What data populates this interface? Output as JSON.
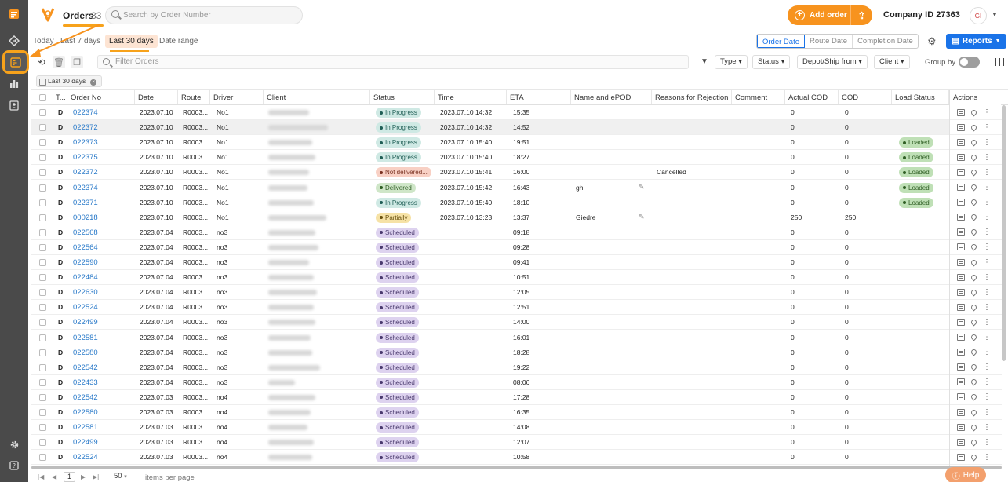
{
  "header": {
    "title": "Orders",
    "count": "33",
    "search_placeholder": "Search by Order Number",
    "add_order": "Add order",
    "company": "Company ID 27363",
    "avatar": "GI"
  },
  "date_tabs": [
    "Today",
    "Last 7 days",
    "Last 30 days",
    "Date range"
  ],
  "date_mode": [
    "Order Date",
    "Route Date",
    "Completion Date"
  ],
  "reports_label": "Reports",
  "filter_placeholder": "Filter Orders",
  "dropdowns": [
    "Type",
    "Status",
    "Depot/Ship from",
    "Client"
  ],
  "group_by": "Group by",
  "chip": "Last 30 days",
  "columns": [
    "T...",
    "Order No",
    "Date",
    "Route",
    "Driver",
    "Client",
    "Status",
    "Time",
    "ETA",
    "Name and ePOD",
    "Reasons for Rejection",
    "Comment",
    "Actual COD",
    "COD",
    "Load Status"
  ],
  "actions_label": "Actions",
  "rows": [
    {
      "t": "D",
      "order": "022374",
      "date": "2023.07.10",
      "route": "R0003...",
      "driver": "No1",
      "status": "In Progress",
      "status_type": "progress",
      "time": "2023.07.10 14:32",
      "eta": "15:35",
      "epod": "",
      "pen": false,
      "reason": "",
      "actual_cod": "0",
      "cod": "0",
      "load": ""
    },
    {
      "t": "D",
      "order": "022372",
      "date": "2023.07.10",
      "route": "R0003...",
      "driver": "No1",
      "status": "In Progress",
      "status_type": "progress",
      "time": "2023.07.10 14:32",
      "eta": "14:52",
      "epod": "",
      "pen": false,
      "reason": "",
      "actual_cod": "0",
      "cod": "0",
      "load": ""
    },
    {
      "t": "D",
      "order": "022373",
      "date": "2023.07.10",
      "route": "R0003...",
      "driver": "No1",
      "status": "In Progress",
      "status_type": "progress",
      "time": "2023.07.10 15:40",
      "eta": "19:51",
      "epod": "",
      "pen": false,
      "reason": "",
      "actual_cod": "0",
      "cod": "0",
      "load": "Loaded"
    },
    {
      "t": "D",
      "order": "022375",
      "date": "2023.07.10",
      "route": "R0003...",
      "driver": "No1",
      "status": "In Progress",
      "status_type": "progress",
      "time": "2023.07.10 15:40",
      "eta": "18:27",
      "epod": "",
      "pen": false,
      "reason": "",
      "actual_cod": "0",
      "cod": "0",
      "load": "Loaded"
    },
    {
      "t": "D",
      "order": "022372",
      "date": "2023.07.10",
      "route": "R0003...",
      "driver": "No1",
      "status": "Not delivered...",
      "status_type": "notdel",
      "time": "2023.07.10 15:41",
      "eta": "16:00",
      "epod": "",
      "pen": false,
      "reason": "Cancelled",
      "actual_cod": "0",
      "cod": "0",
      "load": "Loaded"
    },
    {
      "t": "D",
      "order": "022374",
      "date": "2023.07.10",
      "route": "R0003...",
      "driver": "No1",
      "status": "Delivered",
      "status_type": "deliv",
      "time": "2023.07.10 15:42",
      "eta": "16:43",
      "epod": "gh",
      "pen": true,
      "reason": "",
      "actual_cod": "0",
      "cod": "0",
      "load": "Loaded"
    },
    {
      "t": "D",
      "order": "022371",
      "date": "2023.07.10",
      "route": "R0003...",
      "driver": "No1",
      "status": "In Progress",
      "status_type": "progress",
      "time": "2023.07.10 15:40",
      "eta": "18:10",
      "epod": "",
      "pen": false,
      "reason": "",
      "actual_cod": "0",
      "cod": "0",
      "load": "Loaded"
    },
    {
      "t": "D",
      "order": "000218",
      "date": "2023.07.10",
      "route": "R0003...",
      "driver": "No1",
      "status": "Partially",
      "status_type": "partial",
      "time": "2023.07.10 13:23",
      "eta": "13:37",
      "epod": "Giedre",
      "pen": true,
      "reason": "",
      "actual_cod": "250",
      "cod": "250",
      "load": ""
    },
    {
      "t": "D",
      "order": "022568",
      "date": "2023.07.04",
      "route": "R0003...",
      "driver": "no3",
      "status": "Scheduled",
      "status_type": "sched",
      "time": "",
      "eta": "09:18",
      "epod": "",
      "pen": false,
      "reason": "",
      "actual_cod": "0",
      "cod": "0",
      "load": ""
    },
    {
      "t": "D",
      "order": "022564",
      "date": "2023.07.04",
      "route": "R0003...",
      "driver": "no3",
      "status": "Scheduled",
      "status_type": "sched",
      "time": "",
      "eta": "09:28",
      "epod": "",
      "pen": false,
      "reason": "",
      "actual_cod": "0",
      "cod": "0",
      "load": ""
    },
    {
      "t": "D",
      "order": "022590",
      "date": "2023.07.04",
      "route": "R0003...",
      "driver": "no3",
      "status": "Scheduled",
      "status_type": "sched",
      "time": "",
      "eta": "09:41",
      "epod": "",
      "pen": false,
      "reason": "",
      "actual_cod": "0",
      "cod": "0",
      "load": ""
    },
    {
      "t": "D",
      "order": "022484",
      "date": "2023.07.04",
      "route": "R0003...",
      "driver": "no3",
      "status": "Scheduled",
      "status_type": "sched",
      "time": "",
      "eta": "10:51",
      "epod": "",
      "pen": false,
      "reason": "",
      "actual_cod": "0",
      "cod": "0",
      "load": ""
    },
    {
      "t": "D",
      "order": "022630",
      "date": "2023.07.04",
      "route": "R0003...",
      "driver": "no3",
      "status": "Scheduled",
      "status_type": "sched",
      "time": "",
      "eta": "12:05",
      "epod": "",
      "pen": false,
      "reason": "",
      "actual_cod": "0",
      "cod": "0",
      "load": ""
    },
    {
      "t": "D",
      "order": "022524",
      "date": "2023.07.04",
      "route": "R0003...",
      "driver": "no3",
      "status": "Scheduled",
      "status_type": "sched",
      "time": "",
      "eta": "12:51",
      "epod": "",
      "pen": false,
      "reason": "",
      "actual_cod": "0",
      "cod": "0",
      "load": ""
    },
    {
      "t": "D",
      "order": "022499",
      "date": "2023.07.04",
      "route": "R0003...",
      "driver": "no3",
      "status": "Scheduled",
      "status_type": "sched",
      "time": "",
      "eta": "14:00",
      "epod": "",
      "pen": false,
      "reason": "",
      "actual_cod": "0",
      "cod": "0",
      "load": ""
    },
    {
      "t": "D",
      "order": "022581",
      "date": "2023.07.04",
      "route": "R0003...",
      "driver": "no3",
      "status": "Scheduled",
      "status_type": "sched",
      "time": "",
      "eta": "16:01",
      "epod": "",
      "pen": false,
      "reason": "",
      "actual_cod": "0",
      "cod": "0",
      "load": ""
    },
    {
      "t": "D",
      "order": "022580",
      "date": "2023.07.04",
      "route": "R0003...",
      "driver": "no3",
      "status": "Scheduled",
      "status_type": "sched",
      "time": "",
      "eta": "18:28",
      "epod": "",
      "pen": false,
      "reason": "",
      "actual_cod": "0",
      "cod": "0",
      "load": ""
    },
    {
      "t": "D",
      "order": "022542",
      "date": "2023.07.04",
      "route": "R0003...",
      "driver": "no3",
      "status": "Scheduled",
      "status_type": "sched",
      "time": "",
      "eta": "19:22",
      "epod": "",
      "pen": false,
      "reason": "",
      "actual_cod": "0",
      "cod": "0",
      "load": ""
    },
    {
      "t": "D",
      "order": "022433",
      "date": "2023.07.04",
      "route": "R0003...",
      "driver": "no3",
      "status": "Scheduled",
      "status_type": "sched",
      "time": "",
      "eta": "08:06",
      "epod": "",
      "pen": false,
      "reason": "",
      "actual_cod": "0",
      "cod": "0",
      "load": ""
    },
    {
      "t": "D",
      "order": "022542",
      "date": "2023.07.03",
      "route": "R0003...",
      "driver": "no4",
      "status": "Scheduled",
      "status_type": "sched",
      "time": "",
      "eta": "17:28",
      "epod": "",
      "pen": false,
      "reason": "",
      "actual_cod": "0",
      "cod": "0",
      "load": ""
    },
    {
      "t": "D",
      "order": "022580",
      "date": "2023.07.03",
      "route": "R0003...",
      "driver": "no4",
      "status": "Scheduled",
      "status_type": "sched",
      "time": "",
      "eta": "16:35",
      "epod": "",
      "pen": false,
      "reason": "",
      "actual_cod": "0",
      "cod": "0",
      "load": ""
    },
    {
      "t": "D",
      "order": "022581",
      "date": "2023.07.03",
      "route": "R0003...",
      "driver": "no4",
      "status": "Scheduled",
      "status_type": "sched",
      "time": "",
      "eta": "14:08",
      "epod": "",
      "pen": false,
      "reason": "",
      "actual_cod": "0",
      "cod": "0",
      "load": ""
    },
    {
      "t": "D",
      "order": "022499",
      "date": "2023.07.03",
      "route": "R0003...",
      "driver": "no4",
      "status": "Scheduled",
      "status_type": "sched",
      "time": "",
      "eta": "12:07",
      "epod": "",
      "pen": false,
      "reason": "",
      "actual_cod": "0",
      "cod": "0",
      "load": ""
    },
    {
      "t": "D",
      "order": "022524",
      "date": "2023.07.03",
      "route": "R0003...",
      "driver": "no4",
      "status": "Scheduled",
      "status_type": "sched",
      "time": "",
      "eta": "10:58",
      "epod": "",
      "pen": false,
      "reason": "",
      "actual_cod": "0",
      "cod": "0",
      "load": ""
    }
  ],
  "pager": {
    "page": "1",
    "page_size": "50",
    "label": "items per page"
  },
  "help": "Help",
  "colors": {
    "accent": "#f7931e",
    "primary": "#1a73e8",
    "sidebar": "#4a4a4a"
  }
}
